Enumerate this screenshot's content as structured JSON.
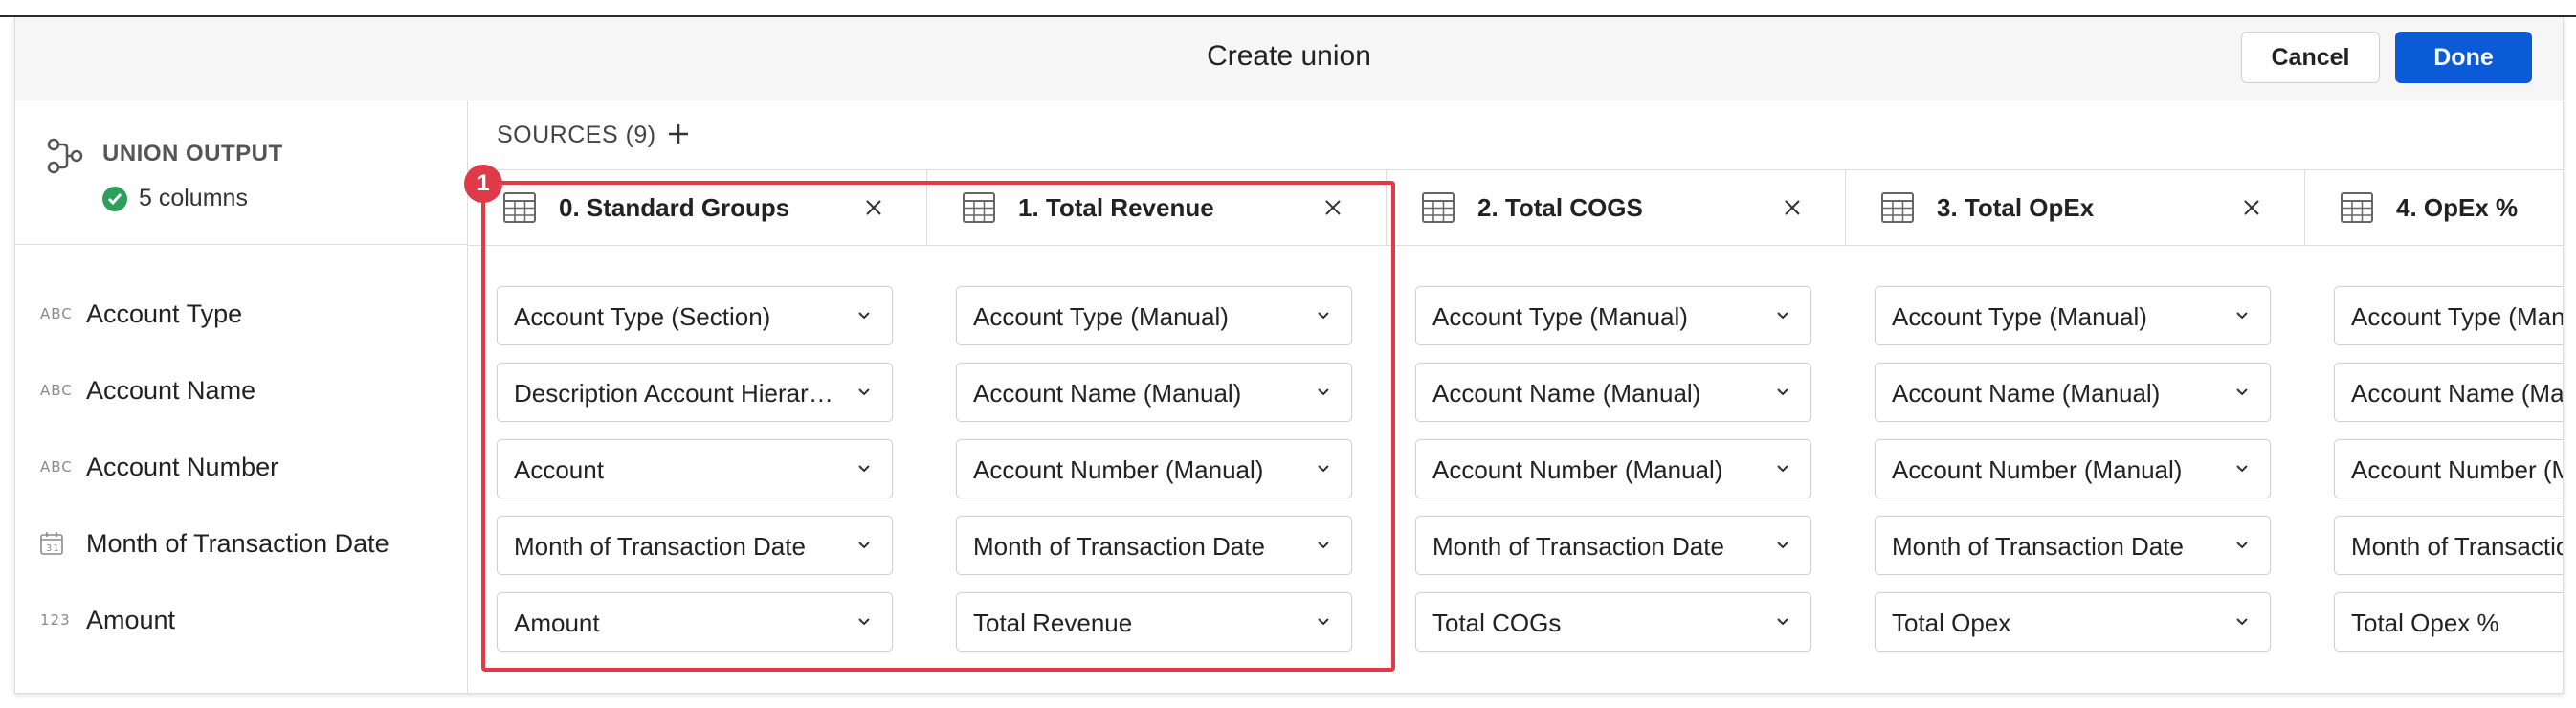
{
  "header": {
    "title": "Create union",
    "cancel_label": "Cancel",
    "done_label": "Done"
  },
  "union_output": {
    "label": "UNION OUTPUT",
    "column_count": "5 columns"
  },
  "fields": [
    {
      "type_icon": "ABC",
      "name": "Account Type"
    },
    {
      "type_icon": "ABC",
      "name": "Account Name"
    },
    {
      "type_icon": "ABC",
      "name": "Account Number"
    },
    {
      "type_icon": "calendar-icon",
      "name": "Month of Transaction Date"
    },
    {
      "type_icon": "123",
      "name": "Amount"
    }
  ],
  "sources_label": "SOURCES (9)",
  "sources": [
    {
      "title": "0. Standard Groups",
      "values": [
        "Account Type (Section)",
        "Description Account Hierarchy",
        "Account",
        "Month of Transaction Date",
        "Amount"
      ]
    },
    {
      "title": "1. Total Revenue",
      "values": [
        "Account Type (Manual)",
        "Account Name (Manual)",
        "Account Number (Manual)",
        "Month of Transaction Date",
        "Total Revenue"
      ]
    },
    {
      "title": "2. Total COGS",
      "values": [
        "Account Type (Manual)",
        "Account Name (Manual)",
        "Account Number (Manual)",
        "Month of Transaction Date",
        "Total COGs"
      ]
    },
    {
      "title": "3. Total OpEx",
      "values": [
        "Account Type (Manual)",
        "Account Name (Manual)",
        "Account Number (Manual)",
        "Month of Transaction Date",
        "Total Opex"
      ]
    },
    {
      "title": "4. OpEx %",
      "values": [
        "Account Type (Manual)",
        "Account Name (Manual)",
        "Account Number (Manual)",
        "Month of Transaction Date",
        "Total Opex %"
      ]
    }
  ],
  "annotation": {
    "badge": "1"
  },
  "colors": {
    "accent": "#0b5bd7",
    "highlight": "#e03a48",
    "success": "#2e9e5b"
  }
}
